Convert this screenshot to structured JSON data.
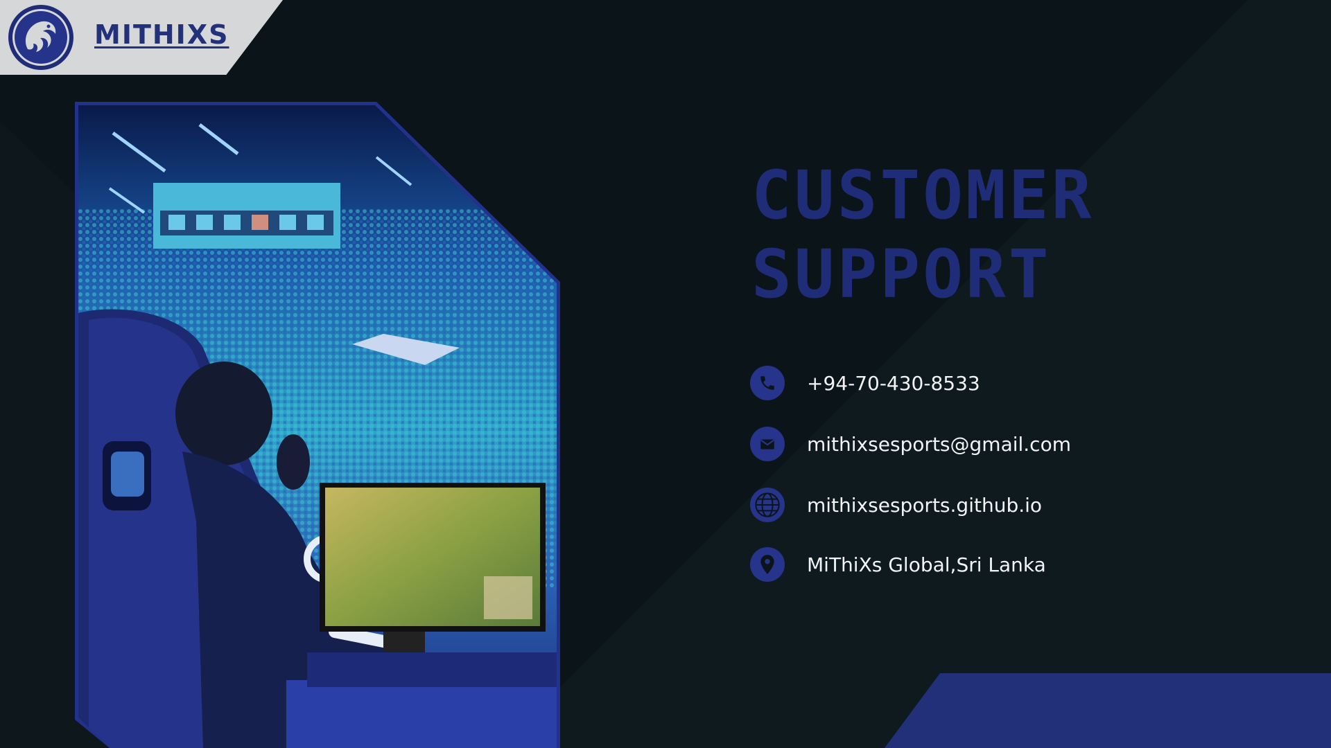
{
  "brand": {
    "name": "MITHIXS",
    "logo_icon": "dragon-emblem-icon"
  },
  "colors": {
    "background": "#0b1418",
    "accent": "#22307a",
    "title": "#1f2c78",
    "text": "#f2f4f6",
    "logo_banner": "#d6d7d9"
  },
  "hero": {
    "image_icon": "esports-gamer-arena-photo"
  },
  "title": {
    "line1": "CUSTOMER",
    "line2": "SUPPORT"
  },
  "contacts": [
    {
      "icon": "phone-icon",
      "text": "+94-70-430-8533"
    },
    {
      "icon": "mail-icon",
      "text": "mithixsesports@gmail.com"
    },
    {
      "icon": "globe-icon",
      "text": "mithixsesports.github.io"
    },
    {
      "icon": "map-pin-icon",
      "text": "MiThiXs Global,Sri Lanka"
    }
  ]
}
